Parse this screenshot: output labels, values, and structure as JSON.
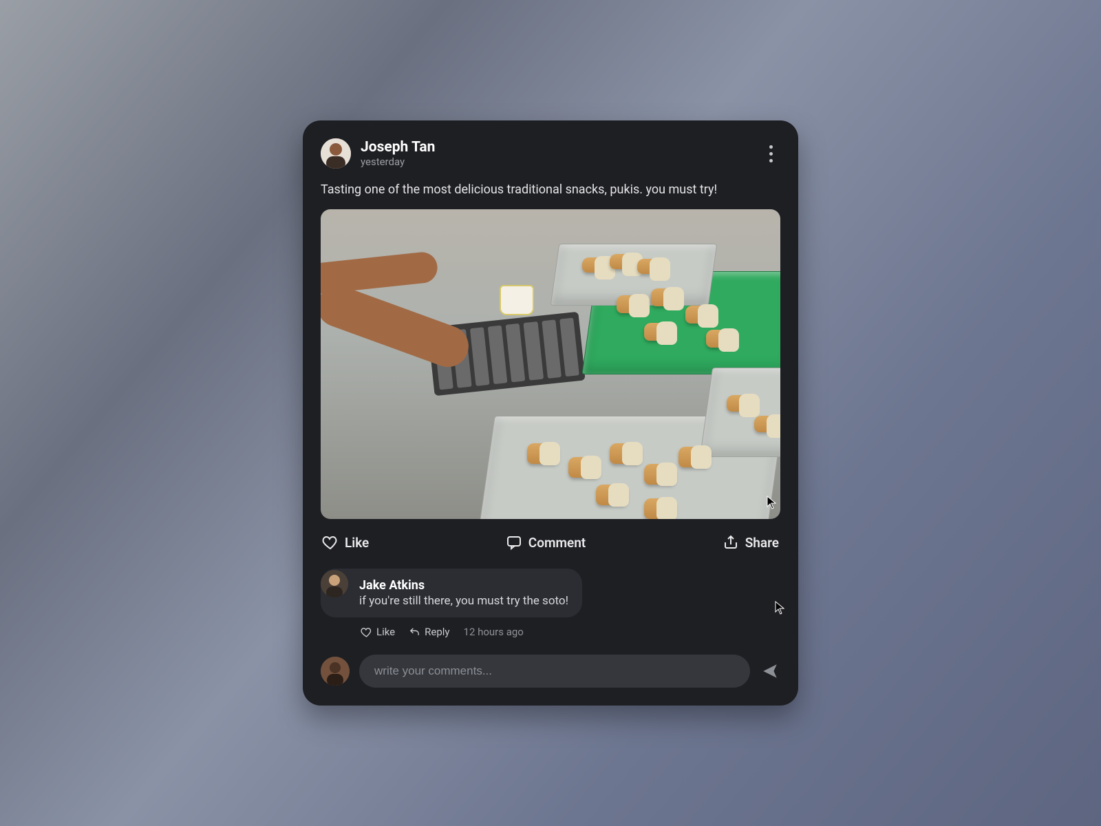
{
  "post": {
    "author": "Joseph Tan",
    "timestamp": "yesterday",
    "body": "Tasting one of the most delicious traditional snacks, pukis. you must try!"
  },
  "actions": {
    "like": "Like",
    "comment": "Comment",
    "share": "Share"
  },
  "comment": {
    "author": "Jake Atkins",
    "text": "if you're still there, you must try the soto!",
    "like": "Like",
    "reply": "Reply",
    "timestamp": "12 hours ago"
  },
  "composer": {
    "placeholder": "write your comments..."
  }
}
